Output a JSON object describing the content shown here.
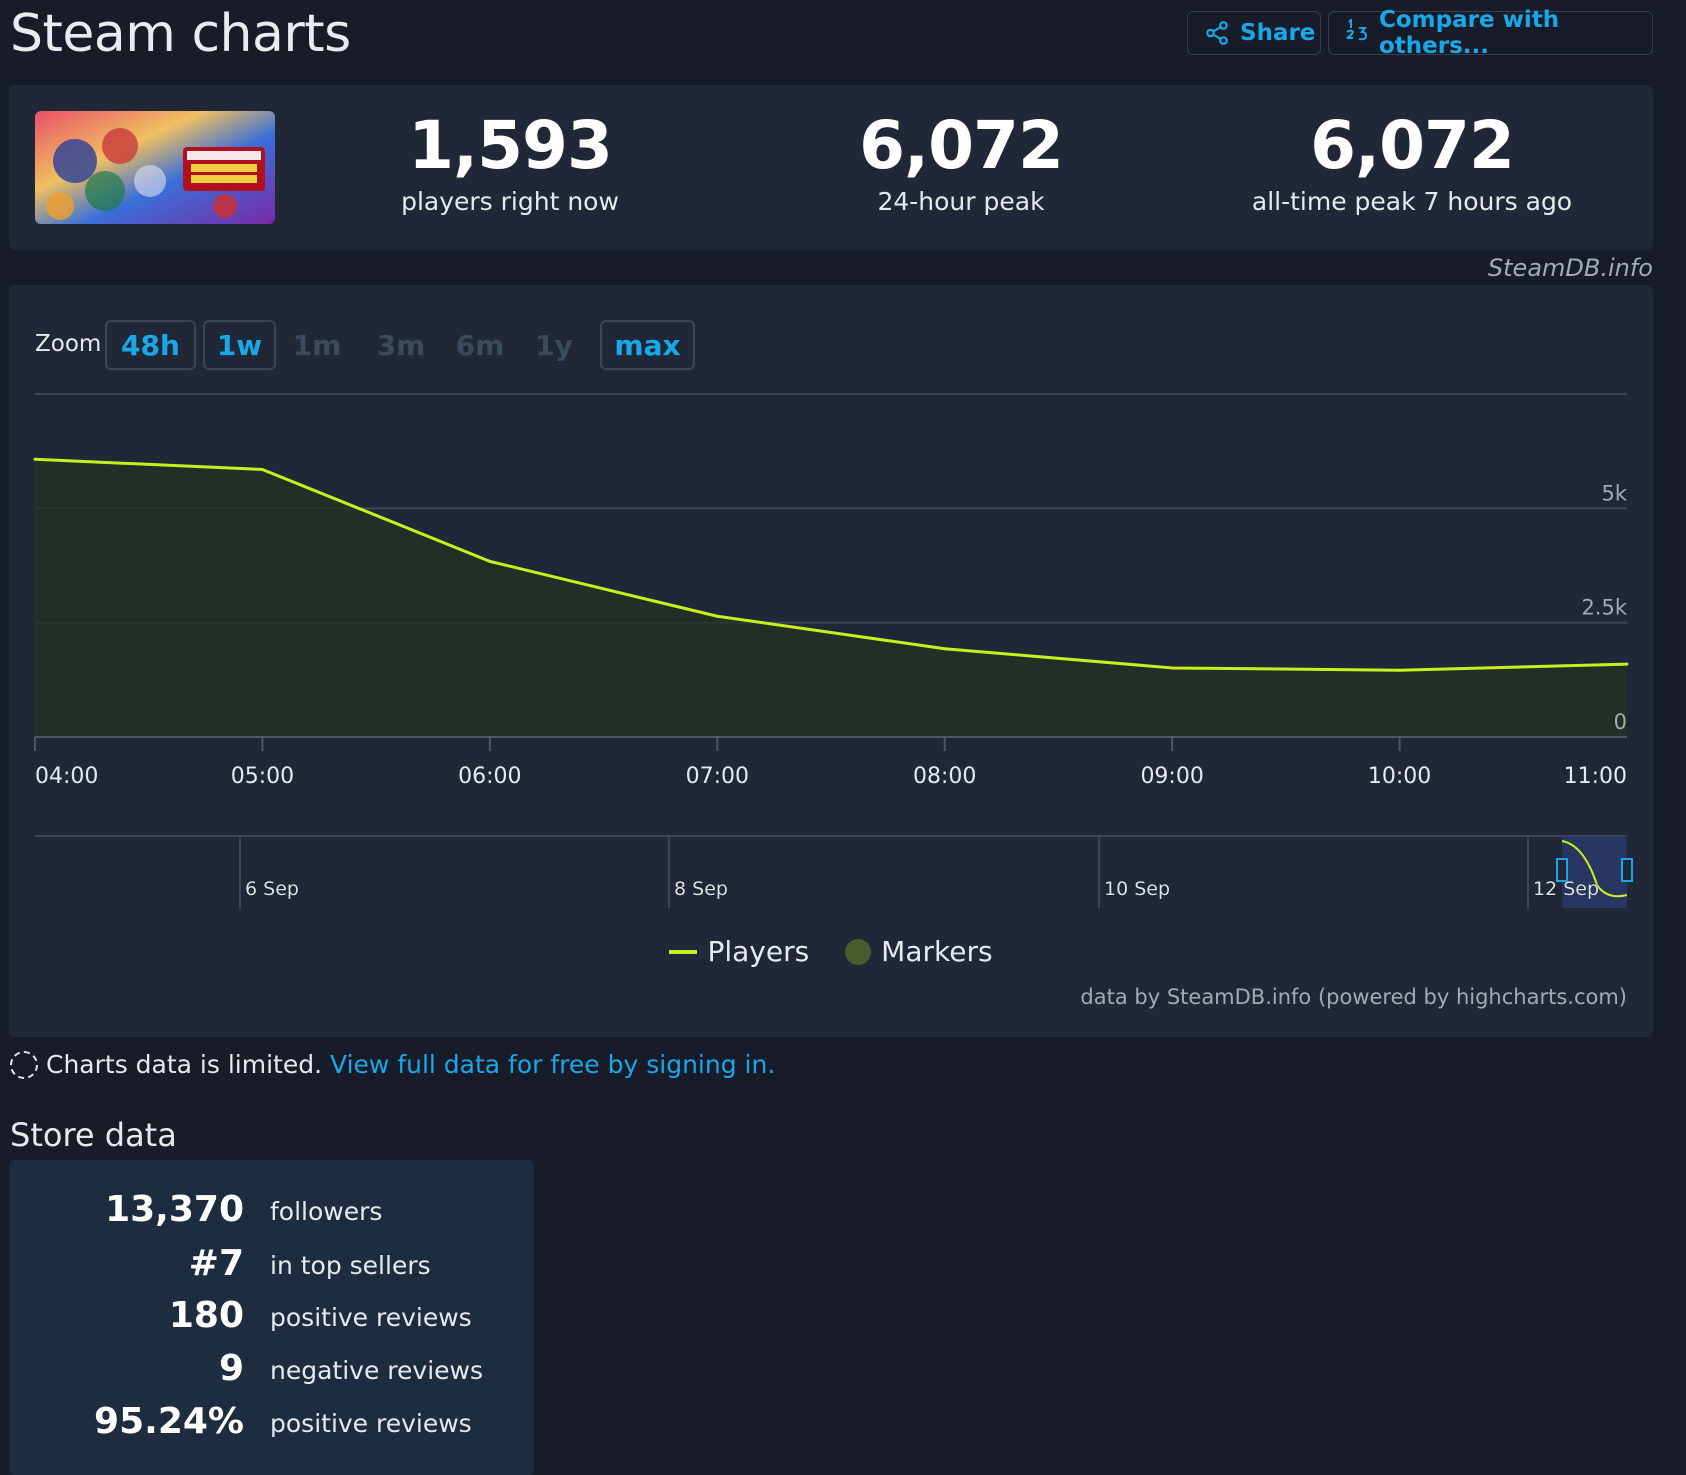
{
  "header": {
    "title": "Steam charts",
    "share_label": "Share",
    "compare_label": "Compare with others..."
  },
  "summary": {
    "current": {
      "value": "1,593",
      "label": "players right now"
    },
    "peak24": {
      "value": "6,072",
      "label": "24-hour peak"
    },
    "alltime": {
      "value": "6,072",
      "label": "all-time peak 7 hours ago"
    },
    "credit": "SteamDB.info"
  },
  "zoom": {
    "label": "Zoom",
    "options": [
      "48h",
      "1w",
      "1m",
      "3m",
      "6m",
      "1y",
      "max"
    ]
  },
  "chart_data": {
    "type": "area",
    "x": [
      "04:00",
      "05:00",
      "06:00",
      "07:00",
      "08:00",
      "09:00",
      "10:00",
      "11:00"
    ],
    "series": [
      {
        "name": "Players",
        "color": "#c8f01e",
        "values": [
          6072,
          5850,
          3840,
          2640,
          1930,
          1510,
          1460,
          1593
        ]
      }
    ],
    "ylim": [
      0,
      7500
    ],
    "yticks": [
      {
        "value": 0,
        "label": "0"
      },
      {
        "value": 2500,
        "label": "2.5k"
      },
      {
        "value": 5000,
        "label": "5k"
      }
    ],
    "xticks": [
      "04:00",
      "05:00",
      "06:00",
      "07:00",
      "08:00",
      "09:00",
      "10:00",
      "11:00"
    ],
    "navigator_labels": [
      "6 Sep",
      "8 Sep",
      "10 Sep",
      "12 Sep"
    ],
    "legend": [
      {
        "name": "Players",
        "color": "#c8f01e"
      },
      {
        "name": "Markers",
        "color": "#4a5b2f"
      }
    ],
    "credit": "data by SteamDB.info (powered by highcharts.com)",
    "grid": true
  },
  "notice": {
    "text": "Charts data is limited.",
    "link": "View full data for free by signing in."
  },
  "store": {
    "title": "Store data",
    "rows": [
      {
        "value": "13,370",
        "label": "followers"
      },
      {
        "value": "#7",
        "label": "in top sellers"
      },
      {
        "value": "180",
        "label": "positive reviews"
      },
      {
        "value": "9",
        "label": "negative reviews"
      },
      {
        "value": "95.24%",
        "label": "positive reviews"
      }
    ]
  }
}
